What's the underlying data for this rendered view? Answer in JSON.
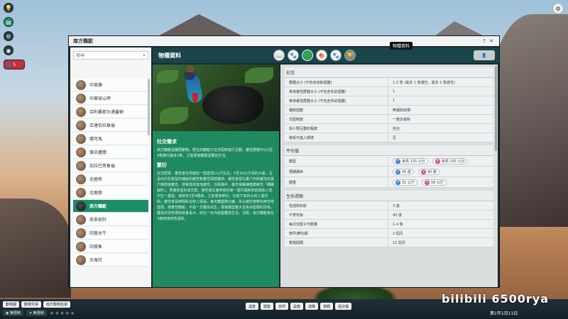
{
  "window": {
    "title": "南方鶴鴕"
  },
  "search": {
    "value": "搜尋"
  },
  "species_list": [
    {
      "name": "中美貘"
    },
    {
      "name": "中華穿山甲"
    },
    {
      "name": "亞利桑那沙漠蓋蜥"
    },
    {
      "name": "亞達伯拉象龜"
    },
    {
      "name": "傑可馬"
    },
    {
      "name": "傑氏獾獴"
    },
    {
      "name": "加拉巴哥象龜"
    },
    {
      "name": "北極熊"
    },
    {
      "name": "北極狼"
    },
    {
      "name": "南方鶴鴕",
      "active": true
    },
    {
      "name": "南非劍羚"
    },
    {
      "name": "印度水牛"
    },
    {
      "name": "印度象"
    },
    {
      "name": "叉角羚"
    }
  ],
  "section_title": "物種資料",
  "tab_tooltip": "物種資料",
  "tabs": [
    {
      "icon": "book-icon",
      "glyph": "📖"
    },
    {
      "icon": "animal-icon",
      "glyph": "🐾"
    },
    {
      "icon": "habitat-icon",
      "glyph": "🌿",
      "active": true
    },
    {
      "icon": "feeding-icon",
      "glyph": "🍖"
    },
    {
      "icon": "paw-icon",
      "glyph": "🐾"
    },
    {
      "icon": "trophy-icon",
      "glyph": "🏆",
      "disabled": true
    }
  ],
  "description": {
    "social_heading": "社交需求",
    "social_text": "南方鶴鴕是獨居動物，野生的鶴鴕只在交配時進行互動，雄性群體可以2至4隻幾代最多3隻，之後便會離開並獨自生活。",
    "breeding_heading": "繁衍",
    "breeding_text": "在交配季，雄性會在地面挖一個直徑1公尺左右、5至10公分深的大巢，這是出於防衛型的補給的雌性和雄性頭部產卵，雌性會留在巢穴內和雄性的巢穴環境後離去，便會尋找其他雄性，在配偶中，雄性會鍛練健康雌性「細緻面料」，照養卵並形成交配，雄性會在產卵後的第一個月裡將卵直接放入地中生一巢蛋，通常有2至4顆卵，之後便會孵化，在接下來的大約三個月間，雄性會長時間趴在卵上保溫，每天離巢數分鐘，所以雌性會孵化時非常虛弱，使雄性鶴鴕，不過一旦雛鳥出生，便會體型變大並長出堅硬的羽毛，雛鳥的羽毛很快就會長大，約在一年內就能獨自生活，交配，南方鶴鴕會在3歲時達到性成熟。"
  },
  "stats": {
    "social": {
      "heading": "社交",
      "rows": [
        {
          "k": "群體大小 (不包含幼齡個體)",
          "v": "1-2 隻 (最多 1 隻雄性，最多 1 隻雌性)"
        },
        {
          "k": "單身雄性群體大小 (不包含年幼個體)",
          "v": "1"
        },
        {
          "k": "單身雌性群體大小 (不包含年幼個體)",
          "v": "1"
        },
        {
          "k": "優勢個體",
          "v": "無優勢結構"
        },
        {
          "k": "交配制度",
          "v": "一雄多雌制"
        },
        {
          "k": "與人類互動的程度",
          "v": "自在"
        },
        {
          "k": "接受可進入環境",
          "v": "否"
        }
      ]
    },
    "average": {
      "heading": "平均值",
      "rows": [
        {
          "k": "體型",
          "m": "身高 125 公分",
          "f": "身高 155 公分"
        },
        {
          "k": "預期壽命",
          "m": "40 歲",
          "f": "40 歲"
        },
        {
          "k": "體重",
          "m": "32 公斤",
          "f": "58 公斤"
        }
      ]
    },
    "life": {
      "heading": "生命週期",
      "rows": [
        {
          "k": "性成熟年齡",
          "v": "3 歲"
        },
        {
          "k": "不育年齡",
          "v": "40 歲"
        },
        {
          "k": "每次交配子代數量",
          "v": "1-4 隻"
        },
        {
          "k": "懷孕/孵化期",
          "v": "2 個月"
        },
        {
          "k": "繁殖間隔",
          "v": "12 個月"
        }
      ]
    }
  },
  "bottombar": {
    "chips_top": [
      "動物園",
      "動物交易",
      "南方動物巡視"
    ],
    "unlimited_label": "無限制",
    "unlimited_label2": "無限制",
    "stars": "★★★★★",
    "mid_buttons": [
      "溫度",
      "建築",
      "自然",
      "設施",
      "道路",
      "景觀",
      "設計圖"
    ],
    "date": "第1年1月11日"
  },
  "watermark": "bilibili 6500rya",
  "hud": {
    "guest_count": "5"
  }
}
